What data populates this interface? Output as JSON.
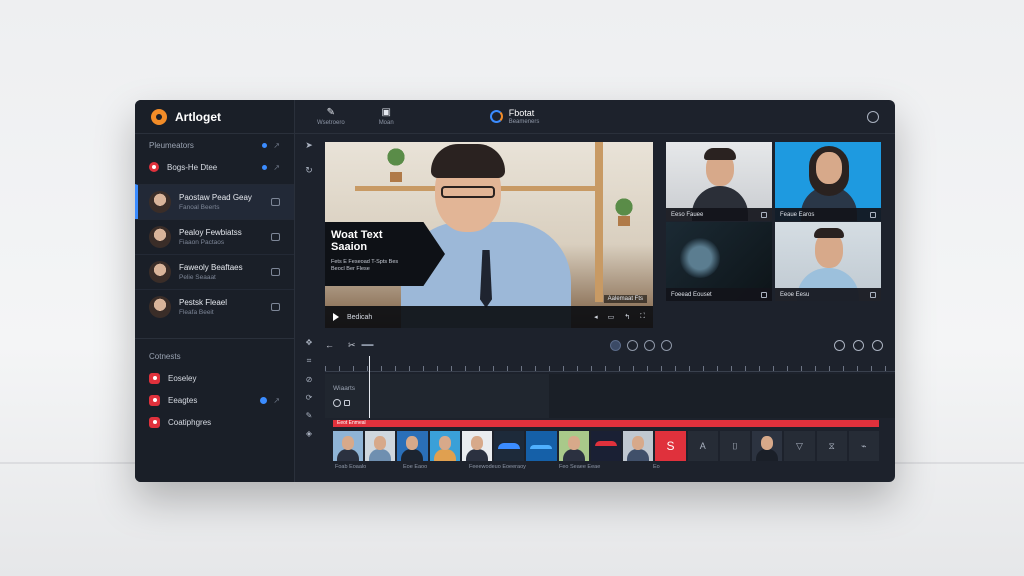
{
  "app": {
    "name": "Artloget"
  },
  "sidebar": {
    "section_title": "Pleumeators",
    "nav_item": {
      "label": "Bogs-He Dtee"
    },
    "contacts": [
      {
        "name": "Paostaw Pead Geay",
        "sub": "Fanoal Beerts"
      },
      {
        "name": "Pealoy Fewbiatss",
        "sub": "Fiaaon Pactaos"
      },
      {
        "name": "Faweoly Beaftaes",
        "sub": "Pelie Seaaat"
      },
      {
        "name": "Pestsk Fleael",
        "sub": "Fleafa Beeit"
      }
    ],
    "folders_title": "Cotnests",
    "folders": [
      {
        "label": "Eoseley"
      },
      {
        "label": "Eeagtes"
      },
      {
        "label": "Coatiphgres"
      }
    ]
  },
  "topbar": {
    "tools": [
      {
        "icon": "pencil-icon",
        "label": "Wsetroero"
      },
      {
        "icon": "image-icon",
        "label": "Moan"
      }
    ],
    "product": {
      "name": "Fbotat",
      "sub": "Beameners"
    }
  },
  "main_video": {
    "lower_third_title": "Woat Text Saaion",
    "lower_third_sub": "Fets E Feseoad T-Spts Bes Beocl Ber Flese",
    "playbar_label": "Bedicah",
    "time_chip": "Aalemaat Fts"
  },
  "participants": [
    {
      "label": "Eeso Fauee"
    },
    {
      "label": "Feaue Earos"
    },
    {
      "label": "Foeead Eouset"
    },
    {
      "label": "Eeoe Eesu"
    }
  ],
  "timeline": {
    "track_label": "Wiaarts",
    "strip_label": "Eeot Enmeal",
    "thumb_red_glyph": "S",
    "thumb_empty_glyph": "A",
    "captions": [
      "Foab Eoaalo",
      "Eoe Eaoo",
      "Feeewodeuo Eoeeraoy",
      "Feo Seaee Eeae",
      "Eo"
    ]
  }
}
